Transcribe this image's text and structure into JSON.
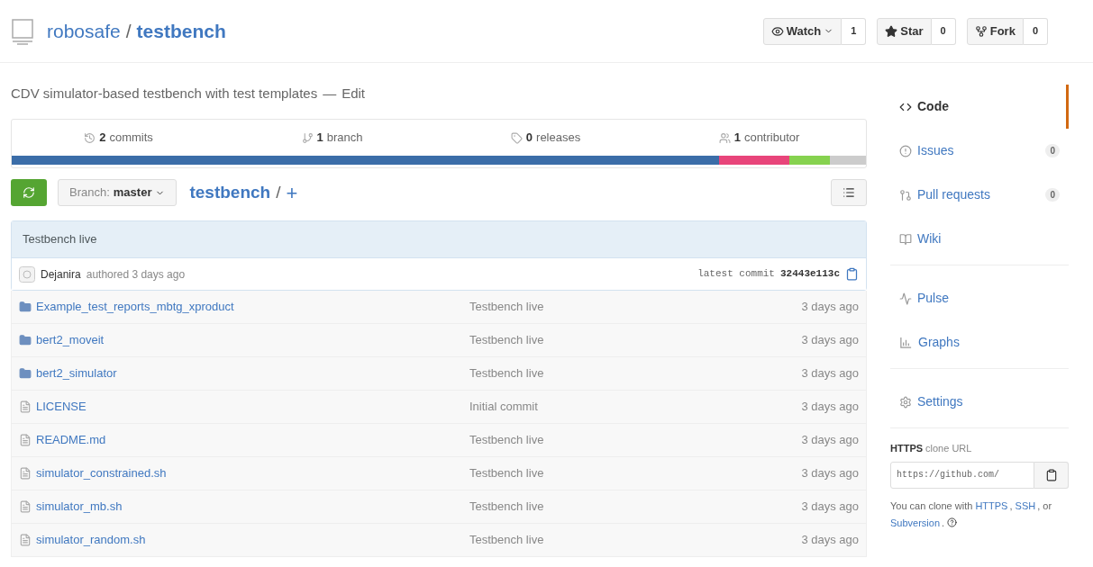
{
  "repo": {
    "owner": "robosafe",
    "separator": "/",
    "name": "testbench"
  },
  "actions": [
    {
      "kind": "watch",
      "label": "Watch",
      "dropdown": true,
      "count": "1"
    },
    {
      "kind": "star",
      "label": "Star",
      "dropdown": false,
      "count": "0"
    },
    {
      "kind": "fork",
      "label": "Fork",
      "dropdown": false,
      "count": "0"
    }
  ],
  "description": {
    "text": "CDV simulator-based testbench with test templates",
    "separator": "—",
    "edit": "Edit"
  },
  "stats": [
    {
      "kind": "commits",
      "count": "2",
      "label": "commits"
    },
    {
      "kind": "branch",
      "count": "1",
      "label": "branch"
    },
    {
      "kind": "releases",
      "count": "0",
      "label": "releases"
    },
    {
      "kind": "contributors",
      "count": "1",
      "label": "contributor"
    }
  ],
  "branch": {
    "label": "Branch:",
    "name": "master"
  },
  "breadcrumb": {
    "repo": "testbench",
    "separator": "/",
    "add": "+"
  },
  "commit": {
    "message": "Testbench live",
    "author": "Dejanira",
    "meta": "authored 3 days ago",
    "label": "latest commit",
    "sha": "32443e113c"
  },
  "files": [
    {
      "kind": "dir",
      "name": "Example_test_reports_mbtg_xproduct",
      "message": "Testbench live",
      "age": "3 days ago"
    },
    {
      "kind": "dir",
      "name": "bert2_moveit",
      "message": "Testbench live",
      "age": "3 days ago"
    },
    {
      "kind": "dir",
      "name": "bert2_simulator",
      "message": "Testbench live",
      "age": "3 days ago"
    },
    {
      "kind": "file",
      "name": "LICENSE",
      "message": "Initial commit",
      "age": "3 days ago"
    },
    {
      "kind": "file",
      "name": "README.md",
      "message": "Testbench live",
      "age": "3 days ago"
    },
    {
      "kind": "file",
      "name": "simulator_constrained.sh",
      "message": "Testbench live",
      "age": "3 days ago"
    },
    {
      "kind": "file",
      "name": "simulator_mb.sh",
      "message": "Testbench live",
      "age": "3 days ago"
    },
    {
      "kind": "file",
      "name": "simulator_random.sh",
      "message": "Testbench live",
      "age": "3 days ago"
    }
  ],
  "nav_groups": [
    {
      "items": [
        {
          "kind": "code",
          "label": "Code",
          "selected": true
        },
        {
          "kind": "issues",
          "label": "Issues",
          "selected": false,
          "count": "0"
        },
        {
          "kind": "pulls",
          "label": "Pull requests",
          "selected": false,
          "count": "0"
        },
        {
          "kind": "wiki",
          "label": "Wiki",
          "selected": false
        }
      ]
    },
    {
      "items": [
        {
          "kind": "pulse",
          "label": "Pulse",
          "selected": false
        },
        {
          "kind": "graphs",
          "label": "Graphs",
          "selected": false
        }
      ]
    },
    {
      "items": [
        {
          "kind": "settings",
          "label": "Settings",
          "selected": false
        }
      ]
    }
  ],
  "clone": {
    "protocol": "HTTPS",
    "label": "clone URL",
    "url": "https://github.com/"
  },
  "clone_help": [
    {
      "text": "You can clone with ",
      "link": false
    },
    {
      "text": "HTTPS",
      "link": true
    },
    {
      "text": ", ",
      "link": false
    },
    {
      "text": "SSH",
      "link": true
    },
    {
      "text": ", or ",
      "link": false
    },
    {
      "text": "Subversion",
      "link": true
    },
    {
      "text": ".",
      "link": false
    }
  ]
}
